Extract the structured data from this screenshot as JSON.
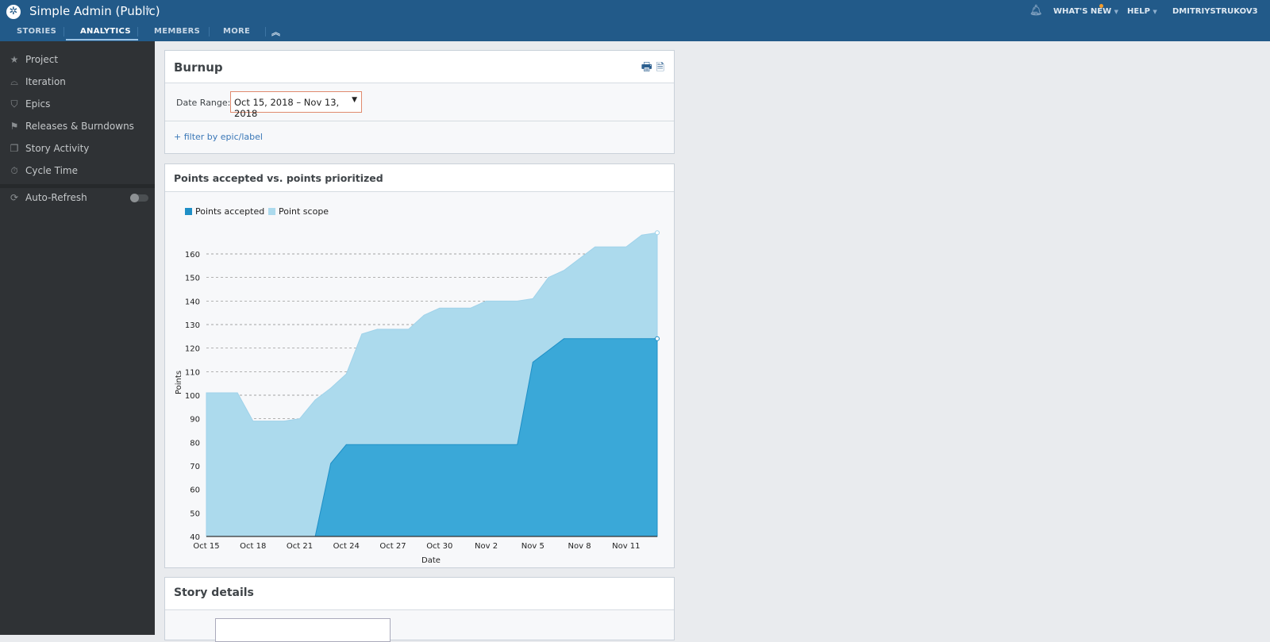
{
  "header": {
    "project_title": "Simple Admin (Public)",
    "tabs": [
      "STORIES",
      "ANALYTICS",
      "MEMBERS",
      "MORE"
    ],
    "active_tab": "ANALYTICS",
    "whats_new": "WHAT'S NEW",
    "help": "HELP",
    "user": "DMITRIYSTRUKOV3",
    "notification_dot_color": "#f39c2c"
  },
  "sidebar": {
    "items": [
      {
        "label": "Project",
        "icon": "star-icon"
      },
      {
        "label": "Iteration",
        "icon": "iteration-icon"
      },
      {
        "label": "Epics",
        "icon": "shield-icon"
      },
      {
        "label": "Releases & Burndowns",
        "icon": "flag-icon"
      },
      {
        "label": "Story Activity",
        "icon": "activity-icon"
      },
      {
        "label": "Cycle Time",
        "icon": "stopwatch-icon"
      }
    ],
    "auto_refresh": {
      "label": "Auto-Refresh",
      "enabled": false
    }
  },
  "burnup": {
    "title": "Burnup",
    "date_range_label": "Date Range:",
    "date_range_value": "Oct 15, 2018 – Nov 13, 2018",
    "filter_link": "+ filter by epic/label"
  },
  "chart_card": {
    "title": "Points accepted vs. points prioritized"
  },
  "chart_data": {
    "type": "area",
    "xlabel": "Date",
    "ylabel": "Points",
    "ylim": [
      40,
      170
    ],
    "grid": true,
    "legend": "top-left",
    "yticks": [
      40,
      50,
      60,
      70,
      80,
      90,
      100,
      110,
      120,
      130,
      140,
      150,
      160
    ],
    "xticks": [
      "Oct 15",
      "Oct 18",
      "Oct 21",
      "Oct 24",
      "Oct 27",
      "Oct 30",
      "Nov 2",
      "Nov 5",
      "Nov 8",
      "Nov 11"
    ],
    "x": [
      "Oct 15",
      "Oct 16",
      "Oct 17",
      "Oct 18",
      "Oct 19",
      "Oct 20",
      "Oct 21",
      "Oct 22",
      "Oct 23",
      "Oct 24",
      "Oct 25",
      "Oct 26",
      "Oct 27",
      "Oct 28",
      "Oct 29",
      "Oct 30",
      "Oct 31",
      "Nov 1",
      "Nov 2",
      "Nov 3",
      "Nov 4",
      "Nov 5",
      "Nov 6",
      "Nov 7",
      "Nov 8",
      "Nov 9",
      "Nov 10",
      "Nov 11",
      "Nov 12",
      "Nov 13"
    ],
    "series": [
      {
        "name": "Point scope",
        "color": "#acdaed",
        "values": [
          101,
          101,
          101,
          89,
          89,
          89,
          90,
          98,
          103,
          109,
          126,
          128,
          128,
          128,
          134,
          137,
          137,
          137,
          140,
          140,
          140,
          141,
          150,
          153,
          158,
          163,
          163,
          163,
          168,
          169
        ]
      },
      {
        "name": "Points accepted",
        "color": "#3aa8d8",
        "values": [
          0,
          0,
          0,
          0,
          0,
          0,
          0,
          0,
          71,
          79,
          79,
          79,
          79,
          79,
          79,
          79,
          79,
          79,
          79,
          79,
          79,
          114,
          119,
          124,
          124,
          124,
          124,
          124,
          124,
          124
        ]
      }
    ]
  },
  "story_details": {
    "title": "Story details"
  }
}
